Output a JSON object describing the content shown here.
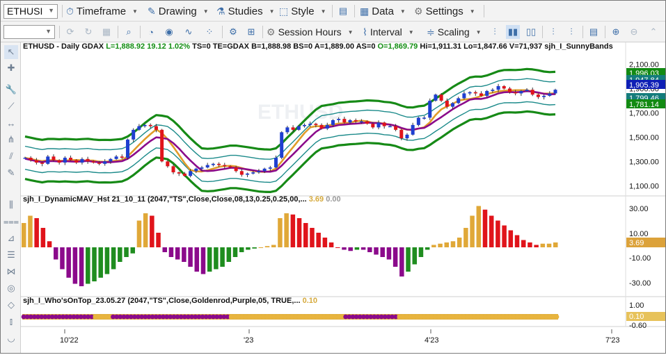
{
  "toolbar": {
    "symbol": "ETHUSI",
    "timeframe": "Timeframe",
    "drawing": "Drawing",
    "studies": "Studies",
    "style": "Style",
    "data": "Data",
    "settings": "Settings",
    "session_hours": "Session Hours",
    "interval": "Interval",
    "scaling": "Scaling"
  },
  "header": {
    "symbol_info": "ETHUSD - Daily  GDAX",
    "last": "L=1,888.92",
    "change": "19.12",
    "pct": "1.02%",
    "rest": "TS=0  TE=GDAX  B=1,888.98  BS=0  A=1,889.00  AS=0",
    "open": "O=1,869.79",
    "hilo": "Hi=1,911.31  Lo=1,847.66  V=71,937",
    "study": "sjh_I_SunnyBands"
  },
  "price_axis": {
    "ticks": [
      "2,100.00",
      "1,900.00",
      "1,700.00",
      "1,500.00",
      "1,300.00",
      "1,100.00"
    ],
    "tags": [
      {
        "label": "1,996.03",
        "color": "#128a12"
      },
      {
        "label": "1,947.84",
        "color": "#147c7c"
      },
      {
        "label": "1,905.39",
        "color": "#0e1fb5"
      },
      {
        "label": "1,799.46",
        "color": "#147c7c"
      },
      {
        "label": "1,781.14",
        "color": "#128a12"
      }
    ]
  },
  "histogram": {
    "title": "sjh_I_DynamicMAV_Hst 21_10_11 (2047,\"TS\",Close,Close,08,13,0.25,0.25,00,...",
    "value1": "3.69",
    "value2": "0.00",
    "ticks": [
      "30.00",
      "10.00",
      "-10.00",
      "-30.00"
    ],
    "tag": "3.69"
  },
  "whos_on_top": {
    "title": "sjh_I_Who'sOnTop_23.05.27 (2047,\"TS\",Close,Goldenrod,Purple,05,  TRUE,...",
    "value": "0.10",
    "ticks": [
      "1.00",
      "-0.60"
    ],
    "tag": "0.10"
  },
  "time_axis": [
    "10'22",
    "'23",
    "4'23",
    "7'23"
  ],
  "watermark": "ETHUSD",
  "colors": {
    "bull": "#1f3fd0",
    "bear": "#e0141b",
    "outer_band": "#168a16",
    "inner_band": "#1b8a8a",
    "ma_purple": "#8b0a8b",
    "ma_gold": "#e09c2a",
    "hist_gold": "#e0a838",
    "hist_red": "#e0141b",
    "hist_purple": "#8b0a8b",
    "hist_green": "#1f8d1f"
  },
  "chart_data": {
    "type": "candlestick",
    "series": [
      {
        "name": "ETHUSD",
        "close": [
          1330,
          1310,
          1290,
          1280,
          1340,
          1310,
          1290,
          1330,
          1310,
          1290,
          1320,
          1300,
          1290,
          1280,
          1300,
          1320,
          1340,
          1330,
          1480,
          1560,
          1590,
          1600,
          1590,
          1560,
          1300,
          1260,
          1210,
          1200,
          1180,
          1220,
          1240,
          1250,
          1270,
          1280,
          1270,
          1260,
          1250,
          1220,
          1190,
          1200,
          1210,
          1220,
          1240,
          1250,
          1330,
          1540,
          1580,
          1560,
          1590,
          1600,
          1610,
          1600,
          1570,
          1600,
          1640,
          1650,
          1620,
          1640,
          1630,
          1630,
          1610,
          1580,
          1620,
          1590,
          1590,
          1560,
          1490,
          1520,
          1600,
          1660,
          1660,
          1800,
          1850,
          1800,
          1750,
          1780,
          1820,
          1860,
          1870,
          1860,
          1840,
          1880,
          1890,
          1920,
          1900,
          1870,
          1860,
          1880,
          1890,
          1850,
          1830,
          1840,
          1860,
          1890
        ]
      },
      {
        "name": "sjh_I_DynamicMAV_Hst",
        "values": [
          20,
          26,
          24,
          16,
          5,
          -10,
          -18,
          -25,
          -30,
          -32,
          -30,
          -28,
          -25,
          -22,
          -18,
          -12,
          -8,
          -5,
          22,
          28,
          26,
          12,
          -4,
          -8,
          -10,
          -12,
          -16,
          -20,
          -22,
          -20,
          -18,
          -16,
          -12,
          -8,
          -4,
          -2,
          -1,
          0,
          1,
          2,
          24,
          28,
          27,
          24,
          20,
          16,
          12,
          8,
          4,
          0,
          -2,
          -3,
          -2,
          -2,
          -4,
          -6,
          -8,
          -10,
          -16,
          -24,
          -20,
          -14,
          -8,
          -2,
          2,
          3,
          4,
          5,
          8,
          16,
          26,
          34,
          31,
          26,
          22,
          18,
          14,
          10,
          6,
          4,
          2,
          3,
          3,
          4
        ]
      },
      {
        "name": "sjh_I_Who'sOnTop",
        "values": [
          0.1
        ]
      }
    ],
    "x": [
      "10'22",
      "'23",
      "4'23",
      "7'23"
    ],
    "ylim": [
      1050,
      2200
    ]
  }
}
